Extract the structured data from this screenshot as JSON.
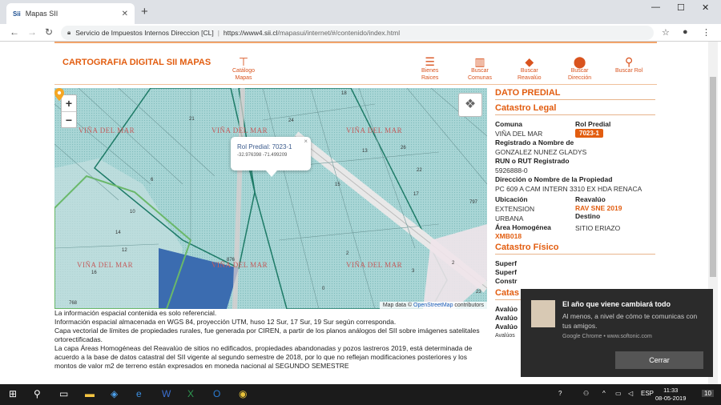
{
  "browser": {
    "tab_title": "Mapas SII",
    "favicon": "Sii",
    "url_site": "Servicio de Impuestos Internos Direccion [CL]",
    "url_host": "https://www4.sii.cl",
    "url_path": "/mapasui/internet/#/contenido/index.html"
  },
  "header": {
    "brand": "CARTOGRAFIA DIGITAL SII MAPAS",
    "catalogo_line1": "Catálogo",
    "catalogo_line2": "Mapas",
    "nav": [
      {
        "line1": "Bienes",
        "line2": "Raices"
      },
      {
        "line1": "Buscar",
        "line2": "Comunas"
      },
      {
        "line1": "Buscar",
        "line2": "Reavalúo"
      },
      {
        "line1": "Buscar",
        "line2": "Dirección"
      },
      {
        "line1": "Buscar Rol",
        "line2": ""
      }
    ]
  },
  "map": {
    "zoom_in": "+",
    "zoom_out": "−",
    "comuna_label": "VIÑA DEL MAR",
    "popup_rol_label": "Rol Predial:",
    "popup_rol_value": "7023-1",
    "popup_coords": "-32.976398  -71.499209",
    "popup_close": "×",
    "attribution_prefix": "Map data © ",
    "attribution_link": "OpenStreetMap",
    "attribution_suffix": " contributors",
    "lot_numbers": [
      "21",
      "6",
      "10",
      "14",
      "12",
      "16",
      "768",
      "876",
      "2",
      "0",
      "13",
      "26",
      "17",
      "22",
      "23",
      "797",
      "15",
      "24",
      "18",
      "2",
      "3"
    ]
  },
  "info_text": [
    "La información espacial contenida es solo referencial.",
    "Información espacial almacenada en WGS 84, proyección UTM, huso 12 Sur, 17 Sur, 19 Sur según corresponda.",
    "Capa vectorial de límites de propiedades rurales, fue generada por CIREN, a partir de los planos análogos del SII sobre imágenes satelitales ortorectificadas.",
    "La capa Áreas Homogéneas del Reavalúo de sitios no edificados, propiedades abandonadas y pozos lastreros 2019, está determinada de acuerdo a la base de datos catastral del SII vigente al segundo semestre de 2018, por lo que no reflejan modificaciones posteriores y los montos de valor m2 de terreno están expresados en moneda nacional al SEGUNDO SEMESTRE"
  ],
  "side": {
    "title": "DATO PREDIAL",
    "catastro_legal": "Catastro Legal",
    "comuna_lbl": "Comuna",
    "comuna_val": "VIÑA DEL MAR",
    "rol_lbl": "Rol Predial",
    "rol_val": "7023-1",
    "registrado_lbl": "Registrado a Nombre de",
    "registrado_val": "GONZALEZ NUNEZ GLADYS",
    "run_lbl": "RUN o RUT Registrado",
    "run_val": "5926888-0",
    "direccion_lbl": "Dirección o Nombre de la Propiedad",
    "direccion_val": "PC 609 A CAM INTERN 3310 EX HDA RENACA",
    "ubicacion_lbl": "Ubicación",
    "ubicacion_val1": "EXTENSION",
    "ubicacion_val2": "URBANA",
    "reavaluo_lbl": "Reavalúo",
    "reavaluo_val": "RAV SNE 2019",
    "destino_lbl": "Destino",
    "destino_val": "SITIO ERIAZO",
    "area_lbl": "Área Homogénea",
    "area_val": "XMB018",
    "catastro_fisico": "Catastro Físico",
    "fis1": "Superf",
    "fis2": "Superf",
    "fis3": "Constr",
    "catas_short": "Catas",
    "aval1": "Avalúo",
    "aval2": "Avalúo",
    "aval3": "Avalúo",
    "aval4": "Avalúos"
  },
  "toast": {
    "title": "El año que viene cambiará todo",
    "body": "Al menos, a nivel de cómo te comunicas con tus amigos.",
    "source": "Google Chrome • www.softonic.com",
    "button": "Cerrar"
  },
  "taskbar": {
    "lang": "ESP",
    "time": "11:33",
    "date": "08-05-2019",
    "notif_count": "10"
  }
}
